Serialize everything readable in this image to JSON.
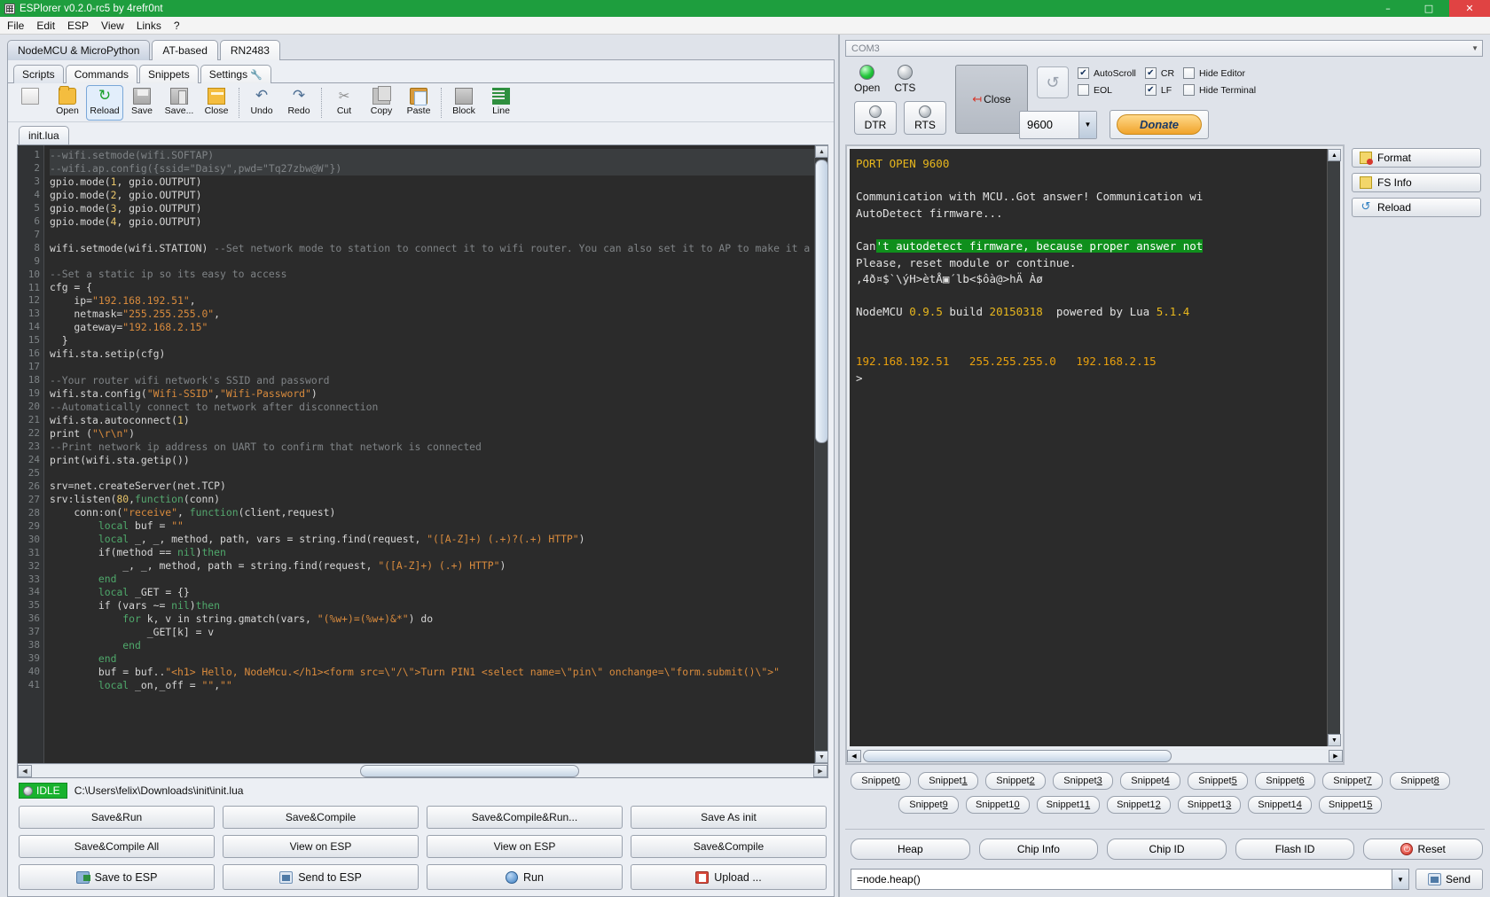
{
  "window": {
    "title": "ESPlorer v0.2.0-rc5 by 4refr0nt",
    "icon": "app-icon",
    "minimize": "–",
    "maximize": "□",
    "close": "✕"
  },
  "menu": [
    "File",
    "Edit",
    "ESP",
    "View",
    "Links",
    "?"
  ],
  "firmware_tabs": [
    {
      "label": "NodeMCU & MicroPython",
      "active": true
    },
    {
      "label": "AT-based",
      "active": false
    },
    {
      "label": "RN2483",
      "active": false
    }
  ],
  "inner_tabs": [
    {
      "label": "Scripts",
      "active": true,
      "icon": ""
    },
    {
      "label": "Commands",
      "active": false,
      "icon": ""
    },
    {
      "label": "Snippets",
      "active": false,
      "icon": ""
    },
    {
      "label": "Settings",
      "active": false,
      "icon": "wrench-icon"
    }
  ],
  "toolbar": [
    {
      "label": "",
      "icon": "new-document-icon",
      "selected": false
    },
    {
      "label": "Open",
      "icon": "open-folder-icon",
      "selected": false
    },
    {
      "label": "Reload",
      "icon": "reload-icon",
      "selected": true
    },
    {
      "label": "Save",
      "icon": "save-icon",
      "selected": false
    },
    {
      "label": "Save...",
      "icon": "save-as-icon",
      "selected": false
    },
    {
      "label": "Close",
      "icon": "close-folder-icon",
      "selected": false
    },
    {
      "label": "Undo",
      "icon": "undo-icon",
      "selected": false
    },
    {
      "label": "Redo",
      "icon": "redo-icon",
      "selected": false
    },
    {
      "label": "Cut",
      "icon": "cut-icon",
      "selected": false
    },
    {
      "label": "Copy",
      "icon": "copy-icon",
      "selected": false
    },
    {
      "label": "Paste",
      "icon": "paste-icon",
      "selected": false
    },
    {
      "label": "Block",
      "icon": "block-icon",
      "selected": false
    },
    {
      "label": "Line",
      "icon": "line-icon",
      "selected": false
    }
  ],
  "file_tab": "init.lua",
  "editor": {
    "first_line": 1,
    "lines": [
      {
        "n": 1,
        "hl": true,
        "html": "<span class='cm'>--wifi.setmode(wifi.SOFTAP)</span>"
      },
      {
        "n": 2,
        "hl": true,
        "html": "<span class='cm'>--wifi.ap.config({ssid=\"Daisy\",pwd=\"Tq27zbw@W\"})</span>"
      },
      {
        "n": 3,
        "hl": false,
        "html": "gpio.mode(<span class='num'>1</span>, gpio.OUTPUT)"
      },
      {
        "n": 4,
        "hl": false,
        "html": "gpio.mode(<span class='num'>2</span>, gpio.OUTPUT)"
      },
      {
        "n": 5,
        "hl": false,
        "html": "gpio.mode(<span class='num'>3</span>, gpio.OUTPUT)"
      },
      {
        "n": 6,
        "hl": false,
        "html": "gpio.mode(<span class='num'>4</span>, gpio.OUTPUT)"
      },
      {
        "n": 7,
        "hl": false,
        "html": ""
      },
      {
        "n": 8,
        "hl": false,
        "html": "wifi.setmode(wifi.STATION) <span class='cm'>--Set network mode to station to connect it to wifi router. You can also set it to AP to make it a access po</span>"
      },
      {
        "n": 9,
        "hl": false,
        "html": ""
      },
      {
        "n": 10,
        "hl": false,
        "html": "<span class='cm'>--Set a static ip so its easy to access</span>"
      },
      {
        "n": 11,
        "hl": false,
        "html": "cfg = {"
      },
      {
        "n": 12,
        "hl": false,
        "html": "    ip=<span class='str'>\"192.168.192.51\"</span>,"
      },
      {
        "n": 13,
        "hl": false,
        "html": "    netmask=<span class='str'>\"255.255.255.0\"</span>,"
      },
      {
        "n": 14,
        "hl": false,
        "html": "    gateway=<span class='str'>\"192.168.2.15\"</span>"
      },
      {
        "n": 15,
        "hl": false,
        "html": "  }"
      },
      {
        "n": 16,
        "hl": false,
        "html": "wifi.sta.setip(cfg)"
      },
      {
        "n": 17,
        "hl": false,
        "html": ""
      },
      {
        "n": 18,
        "hl": false,
        "html": "<span class='cm'>--Your router wifi network's SSID and password</span>"
      },
      {
        "n": 19,
        "hl": false,
        "html": "wifi.sta.config(<span class='str'>\"Wifi-SSID\"</span>,<span class='str'>\"Wifi-Password\"</span>)"
      },
      {
        "n": 20,
        "hl": false,
        "html": "<span class='cm'>--Automatically connect to network after disconnection</span>"
      },
      {
        "n": 21,
        "hl": false,
        "html": "wifi.sta.autoconnect(<span class='num'>1</span>)"
      },
      {
        "n": 22,
        "hl": false,
        "html": "print (<span class='str'>\"\\r\\n\"</span>)"
      },
      {
        "n": 23,
        "hl": false,
        "html": "<span class='cm'>--Print network ip address on UART to confirm that network is connected</span>"
      },
      {
        "n": 24,
        "hl": false,
        "html": "print(wifi.sta.getip())"
      },
      {
        "n": 25,
        "hl": false,
        "html": ""
      },
      {
        "n": 26,
        "hl": false,
        "html": "srv=net.createServer(net.TCP)"
      },
      {
        "n": 27,
        "hl": false,
        "html": "srv:listen(<span class='num'>80</span>,<span class='fn'>function</span>(conn)"
      },
      {
        "n": 28,
        "hl": false,
        "html": "    conn:on(<span class='str'>\"receive\"</span>, <span class='fn'>function</span>(client,request)"
      },
      {
        "n": 29,
        "hl": false,
        "html": "        <span class='kw'>local</span> buf = <span class='str'>\"\"</span>"
      },
      {
        "n": 30,
        "hl": false,
        "html": "        <span class='kw'>local</span> _, _, method, path, vars = string.find(request, <span class='str'>\"([A-Z]+) (.+)?(.+) HTTP\"</span>)"
      },
      {
        "n": 31,
        "hl": false,
        "html": "        if(method == <span class='kw'>nil</span>)<span class='kw'>then</span>"
      },
      {
        "n": 32,
        "hl": false,
        "html": "            _, _, method, path = string.find(request, <span class='str'>\"([A-Z]+) (.+) HTTP\"</span>)"
      },
      {
        "n": 33,
        "hl": false,
        "html": "        <span class='kw'>end</span>"
      },
      {
        "n": 34,
        "hl": false,
        "html": "        <span class='kw'>local</span> _GET = {}"
      },
      {
        "n": 35,
        "hl": false,
        "html": "        if (vars ~= <span class='kw'>nil</span>)<span class='kw'>then</span>"
      },
      {
        "n": 36,
        "hl": false,
        "html": "            <span class='kw'>for</span> k, v in string.gmatch(vars, <span class='str'>\"(%w+)=(%w+)&*\"</span>) do"
      },
      {
        "n": 37,
        "hl": false,
        "html": "                _GET[k] = v"
      },
      {
        "n": 38,
        "hl": false,
        "html": "            <span class='kw'>end</span>"
      },
      {
        "n": 39,
        "hl": false,
        "html": "        <span class='kw'>end</span>"
      },
      {
        "n": 40,
        "hl": false,
        "html": "        buf = buf..<span class='str'>\"&lt;h1&gt; Hello, NodeMcu.&lt;/h1&gt;&lt;form src=\\\"/\\\"&gt;Turn PIN1 &lt;select name=\\\"pin\\\" onchange=\\\"form.submit()\\\"&gt;\"</span>"
      },
      {
        "n": 41,
        "hl": false,
        "html": "        <span class='kw'>local</span> _on,_off = <span class='str'>\"\"</span>,<span class='str'>\"\"</span>"
      }
    ]
  },
  "status": {
    "state": "IDLE",
    "path": "C:\\Users\\felix\\Downloads\\init\\init.lua"
  },
  "actions": {
    "row1": [
      "Save&Run",
      "Save&Compile",
      "Save&Compile&Run...",
      "Save As init"
    ],
    "row2": [
      "Save&Compile All",
      "View on ESP",
      "View on ESP",
      "Save&Compile"
    ],
    "row3": [
      {
        "label": "Save to ESP",
        "icon": "save-to-esp-icon"
      },
      {
        "label": "Send to ESP",
        "icon": "send-to-esp-icon"
      },
      {
        "label": "Run",
        "icon": "run-icon"
      },
      {
        "label": "Upload ...",
        "icon": "upload-icon"
      }
    ]
  },
  "connection": {
    "port": "COM3",
    "leds": [
      {
        "label": "Open",
        "state": "green"
      },
      {
        "label": "CTS",
        "state": "grey"
      }
    ],
    "flow_buttons": [
      {
        "label": "DTR",
        "state": "grey"
      },
      {
        "label": "RTS",
        "state": "grey"
      }
    ],
    "close_button": "Close",
    "refresh_icon": "refresh-icon",
    "baud": "9600",
    "donate": "Donate",
    "checkboxes": [
      {
        "label": "AutoScroll",
        "checked": true
      },
      {
        "label": "EOL",
        "checked": false
      },
      {
        "label": "CR",
        "checked": true
      },
      {
        "label": "LF",
        "checked": true
      },
      {
        "label": "Hide Editor",
        "checked": false
      },
      {
        "label": "Hide Terminal",
        "checked": false
      }
    ]
  },
  "terminal": {
    "lines": [
      {
        "html": "<span class='t-yellow'>PORT OPEN 9600</span>"
      },
      {
        "html": ""
      },
      {
        "html": "Communication with MCU..Got answer! Communication wi"
      },
      {
        "html": "AutoDetect firmware..."
      },
      {
        "html": ""
      },
      {
        "html": "Can<span class='t-hl'>'t autodetect firmware, because proper answer not</span>"
      },
      {
        "html": "Please, reset module or continue."
      },
      {
        "html": ",4ð¤$`\\ýH&gt;ètÅ▣´lb&lt;$ôà@&gt;hÄ Àø"
      },
      {
        "html": ""
      },
      {
        "html": "NodeMCU <span class='t-yellow'>0.9.5</span> build <span class='t-yellow'>20150318</span>  powered by Lua <span class='t-yellow'>5.1.4</span>"
      },
      {
        "html": ""
      },
      {
        "html": ""
      },
      {
        "html": "<span class='t-orange'>192.168.192.51   255.255.255.0   192.168.2.15</span>"
      },
      {
        "html": "&gt;"
      }
    ]
  },
  "side_buttons": [
    {
      "label": "Format",
      "icon": "format-icon"
    },
    {
      "label": "FS Info",
      "icon": "fs-info-icon"
    },
    {
      "label": "Reload",
      "icon": "reload-icon"
    }
  ],
  "snippets": {
    "row1": [
      "Snippet0",
      "Snippet1",
      "Snippet2",
      "Snippet3",
      "Snippet4",
      "Snippet5",
      "Snippet6",
      "Snippet7",
      "Snippet8"
    ],
    "row2": [
      "Snippet9",
      "Snippet10",
      "Snippet11",
      "Snippet12",
      "Snippet13",
      "Snippet14",
      "Snippet15"
    ]
  },
  "info_buttons": [
    {
      "label": "Heap",
      "icon": ""
    },
    {
      "label": "Chip Info",
      "icon": ""
    },
    {
      "label": "Chip ID",
      "icon": ""
    },
    {
      "label": "Flash ID",
      "icon": ""
    },
    {
      "label": "Reset",
      "icon": "power-icon"
    }
  ],
  "command": {
    "value": "=node.heap()",
    "send_label": "Send",
    "send_icon": "send-icon"
  }
}
